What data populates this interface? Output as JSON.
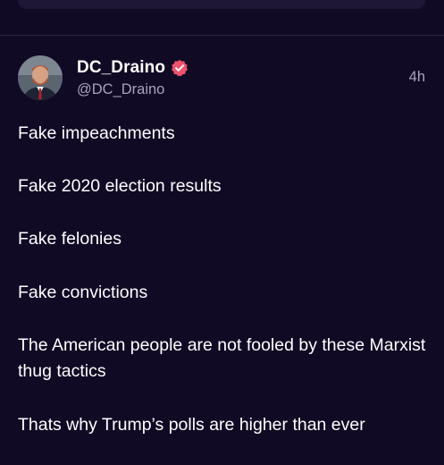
{
  "colors": {
    "background": "#110a24",
    "card": "#1e1736",
    "divider": "#2a2342",
    "text_primary": "#ffffff",
    "text_secondary": "#a9a3bd",
    "verified_badge": "#f0516b"
  },
  "post": {
    "author": {
      "display_name": "DC_Draino",
      "handle": "@DC_Draino",
      "verified_icon": "verified-badge-icon",
      "avatar_icon": "user-avatar"
    },
    "time_ago": "4h",
    "paragraphs": [
      "Fake impeachments",
      "Fake 2020 election results",
      "Fake felonies",
      "Fake convictions",
      "The American people are not fooled by these Marxist thug tactics",
      "Thats why Trump’s polls are higher than ever"
    ]
  }
}
